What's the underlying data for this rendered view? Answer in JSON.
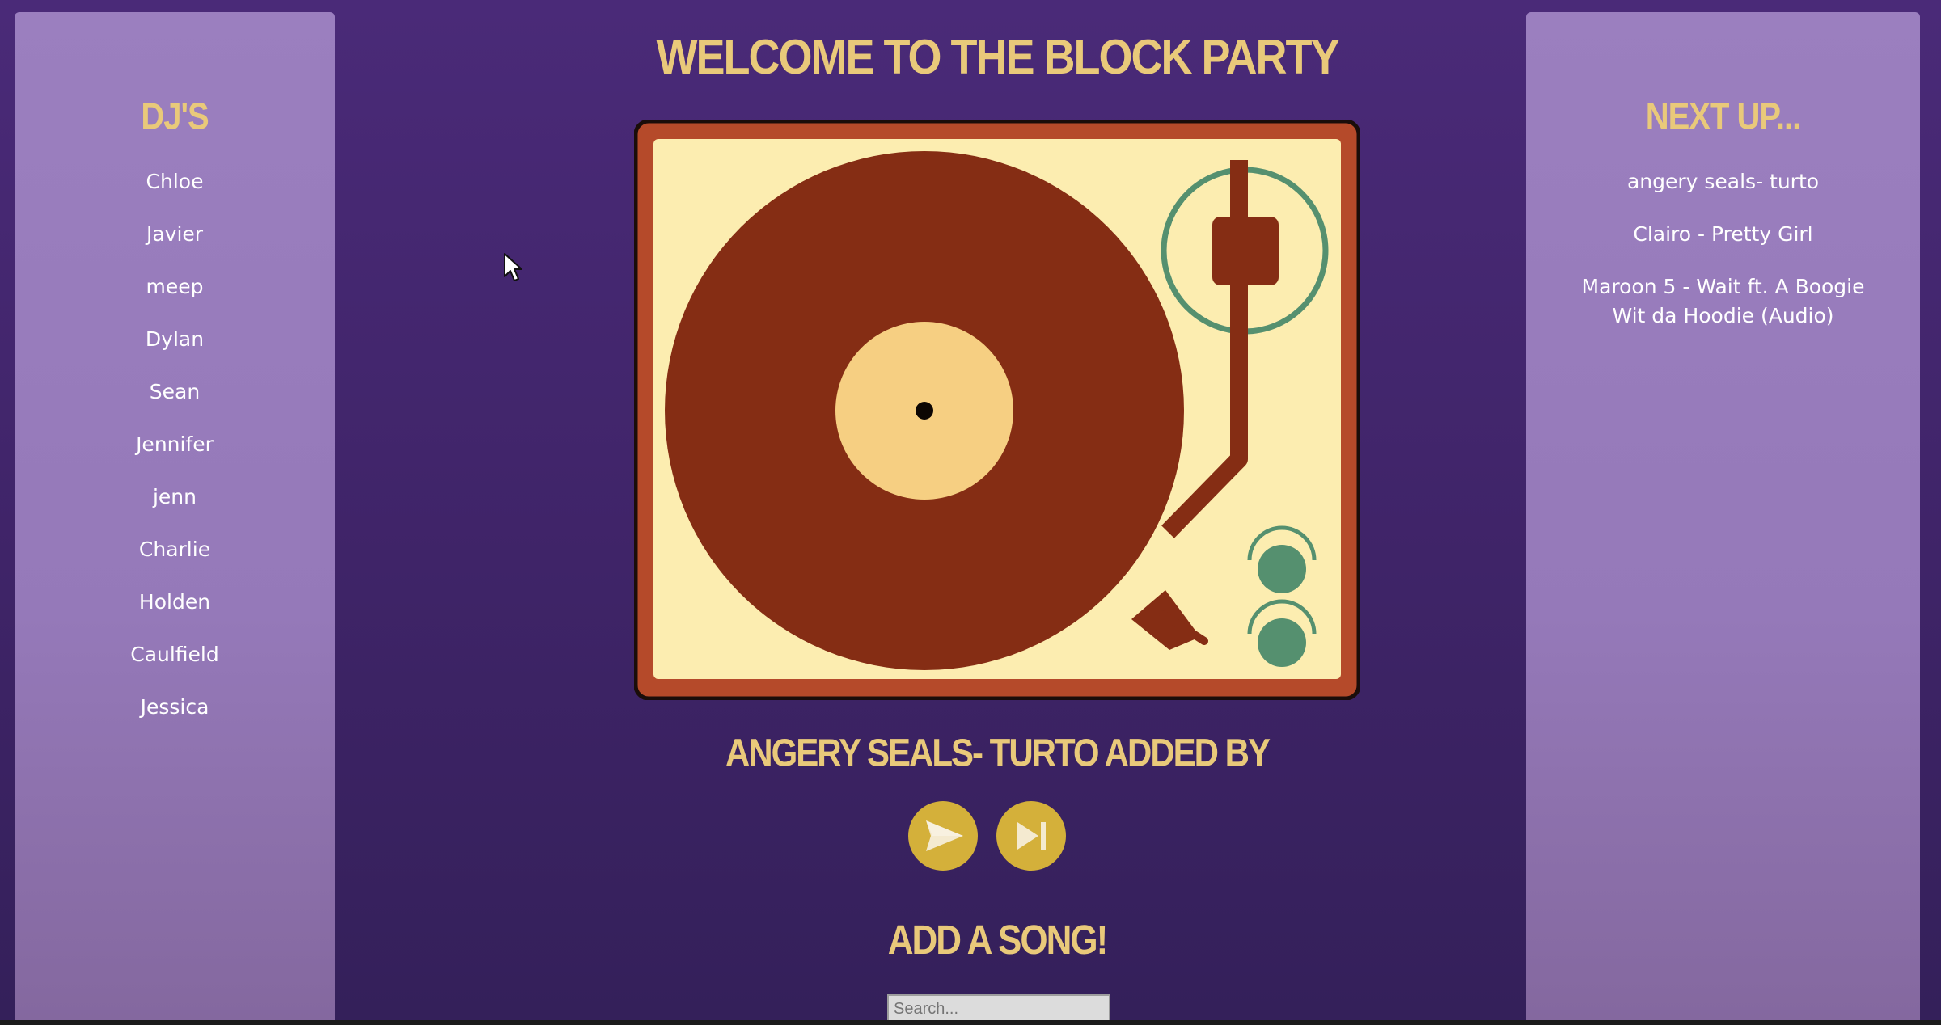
{
  "page": {
    "title": "WELCOME TO THE BLOCK PARTY"
  },
  "djs": {
    "heading": "DJ'S",
    "items": [
      "Chloe",
      "Javier",
      "meep",
      "Dylan",
      "Sean",
      "Jennifer",
      "jenn",
      "Charlie",
      "Holden",
      "Caulfield",
      "Jessica"
    ]
  },
  "queue": {
    "heading": "NEXT UP...",
    "items": [
      "angery seals- turto",
      "Clairo - Pretty Girl",
      "Maroon 5 - Wait ft. A Boogie Wit da Hoodie (Audio)"
    ]
  },
  "player": {
    "now_playing": "ANGERY SEALS- TURTO ADDED BY",
    "play_icon": "send-icon",
    "skip_icon": "skip-next-icon"
  },
  "add_song": {
    "heading": "ADD A SONG!",
    "placeholder": "Search..."
  },
  "colors": {
    "background": "#4a2a78",
    "panel": "#9b7fbf",
    "accent_yellow": "#e9c97a",
    "button_gold": "#d4b03a",
    "record_brown": "#852d14",
    "turntable_cream": "#fcedb0",
    "label_peach": "#f6cf82",
    "knob_green": "#55906f"
  }
}
